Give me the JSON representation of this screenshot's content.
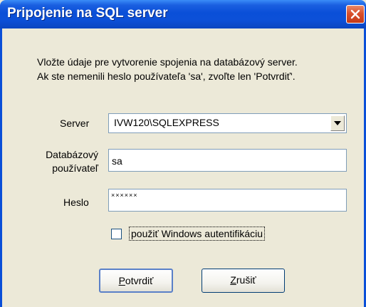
{
  "window": {
    "title": "Pripojenie na SQL server",
    "close_icon": "close-icon"
  },
  "intro": {
    "line1": "Vložte údaje pre vytvorenie spojenia na databázový server.",
    "line2": "Ak ste nemenili heslo používateľa 'sa', zvoľte len 'Potvrdiť'."
  },
  "form": {
    "server_label": "Server",
    "server_value": "IVW120\\SQLEXPRESS",
    "user_label_1": "Databázový",
    "user_label_2": "používateľ",
    "user_value": "sa",
    "password_label": "Heslo",
    "password_value": "××××××",
    "windows_auth_label": "použiť Windows autentifikáciu",
    "windows_auth_checked": false
  },
  "buttons": {
    "ok_mnemonic": "P",
    "ok_rest": "otvrdiť",
    "cancel_mnemonic": "Z",
    "cancel_rest": "rušiť"
  }
}
